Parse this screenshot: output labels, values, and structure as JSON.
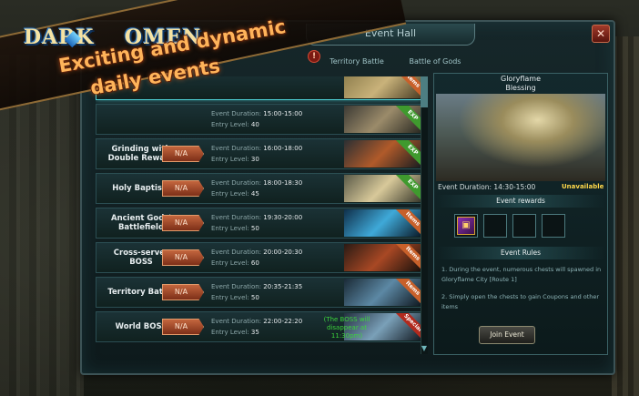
{
  "window": {
    "title": "Event Hall",
    "close_glyph": "✕"
  },
  "tabs": [
    {
      "label": "Territory Battle"
    },
    {
      "label": "Battle of Gods"
    }
  ],
  "alert_glyph": "!",
  "banner": {
    "logo_left": "DARK",
    "logo_right": "OMEN",
    "headline_line1": "Exciting and dynamic",
    "headline_line2": "daily events"
  },
  "events": [
    {
      "name": "",
      "status": "",
      "duration": "",
      "entry_level": "",
      "ribbon": "Items",
      "ribbon_type": "items"
    },
    {
      "name": "",
      "status": "",
      "duration": "15:00-15:00",
      "entry_level": "40",
      "ribbon": "EXP",
      "ribbon_type": "exp"
    },
    {
      "name": "Grinding with Double Reward",
      "status": "N/A",
      "duration": "16:00-18:00",
      "entry_level": "30",
      "ribbon": "EXP",
      "ribbon_type": "exp"
    },
    {
      "name": "Holy Baptism",
      "status": "N/A",
      "duration": "18:00-18:30",
      "entry_level": "45",
      "ribbon": "EXP",
      "ribbon_type": "exp"
    },
    {
      "name": "Ancient Gods' Battlefield",
      "status": "N/A",
      "duration": "19:30-20:00",
      "entry_level": "50",
      "ribbon": "Items",
      "ribbon_type": "items"
    },
    {
      "name": "Cross-server BOSS",
      "status": "N/A",
      "duration": "20:00-20:30",
      "entry_level": "60",
      "ribbon": "Items",
      "ribbon_type": "items"
    },
    {
      "name": "Territory Battle",
      "status": "N/A",
      "duration": "20:35-21:35",
      "entry_level": "50",
      "ribbon": "Items",
      "ribbon_type": "items"
    },
    {
      "name": "World BOSS",
      "status": "N/A",
      "duration": "22:00-22:20",
      "entry_level": "35",
      "ribbon": "Special",
      "ribbon_type": "red",
      "note": "(The BOSS will disappear at 11:30pm)"
    }
  ],
  "labels": {
    "duration": "Event Duration:",
    "entry": "Entry Level:"
  },
  "detail": {
    "title_line1": "Gloryflame",
    "title_line2": "Blessing",
    "duration": "Event Duration: 14:30-15:00",
    "availability": "Unavailable",
    "rewards_header": "Event rewards",
    "rules_header": "Event Rules",
    "rule1": "1. During the event, numerous chests will spawned in Gloryflame City [Route 1]",
    "rule2": "2. Simply open the chests to gain Coupons and other items",
    "join_label": "Join Event",
    "reward_icon": "chest-icon"
  },
  "colors": {
    "accent": "#3b6266",
    "status_button": "#c4663e",
    "unavailable": "#ffd84a",
    "boss_note": "#3cd43c"
  }
}
